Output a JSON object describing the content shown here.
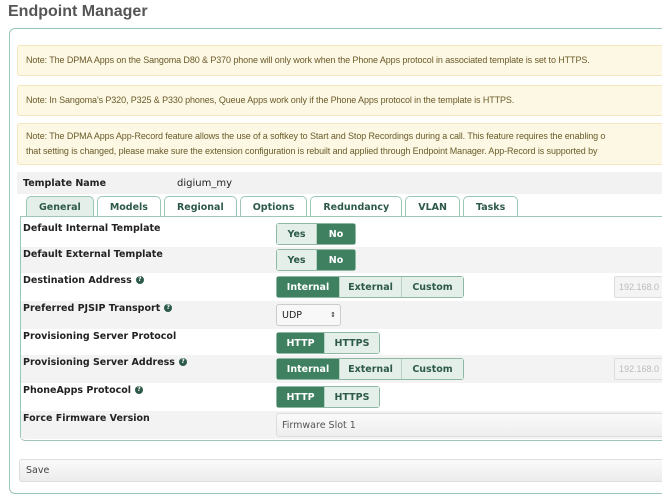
{
  "title": "Endpoint Manager",
  "notes": [
    "Note: The DPMA Apps on the Sangoma D80 & P370 phone will only work when the Phone Apps protocol in associated template is set to HTTPS.",
    "Note: In Sangoma's P320, P325 & P330 phones, Queue Apps work only if the Phone Apps protocol in the template is HTTPS.",
    "Note: The DPMA Apps App-Record feature allows the use of a softkey to Start and Stop Recordings during a call. This feature requires the enabling o",
    "that setting is changed, please make sure the extension configuration is rebuilt and applied through Endpoint Manager. App-Record is supported by"
  ],
  "template": {
    "label": "Template Name",
    "value": "digium_my"
  },
  "tabs": [
    "General",
    "Models",
    "Regional",
    "Options",
    "Redundancy",
    "VLAN",
    "Tasks"
  ],
  "active_tab": "General",
  "fields": {
    "default_internal": {
      "label": "Default Internal Template",
      "options": [
        "Yes",
        "No"
      ],
      "selected": "No"
    },
    "default_external": {
      "label": "Default External Template",
      "options": [
        "Yes",
        "No"
      ],
      "selected": "No"
    },
    "destination": {
      "label": "Destination Address",
      "options": [
        "Internal",
        "External",
        "Custom"
      ],
      "selected": "Internal",
      "address": "192.168.0"
    },
    "pjsip": {
      "label": "Preferred PJSIP Transport",
      "value": "UDP"
    },
    "prov_protocol": {
      "label": "Provisioning Server Protocol",
      "options": [
        "HTTP",
        "HTTPS"
      ],
      "selected": "HTTP"
    },
    "prov_address": {
      "label": "Provisioning Server Address",
      "options": [
        "Internal",
        "External",
        "Custom"
      ],
      "selected": "Internal",
      "address": "192.168.0"
    },
    "phoneapps": {
      "label": "PhoneApps Protocol",
      "options": [
        "HTTP",
        "HTTPS"
      ],
      "selected": "HTTP"
    },
    "firmware": {
      "label": "Force Firmware Version",
      "value": "Firmware Slot 1"
    }
  },
  "save_label": "Save",
  "colors": {
    "accent": "#3e8060",
    "accent_light": "#e4efea",
    "note_bg": "#fcf8e3"
  }
}
